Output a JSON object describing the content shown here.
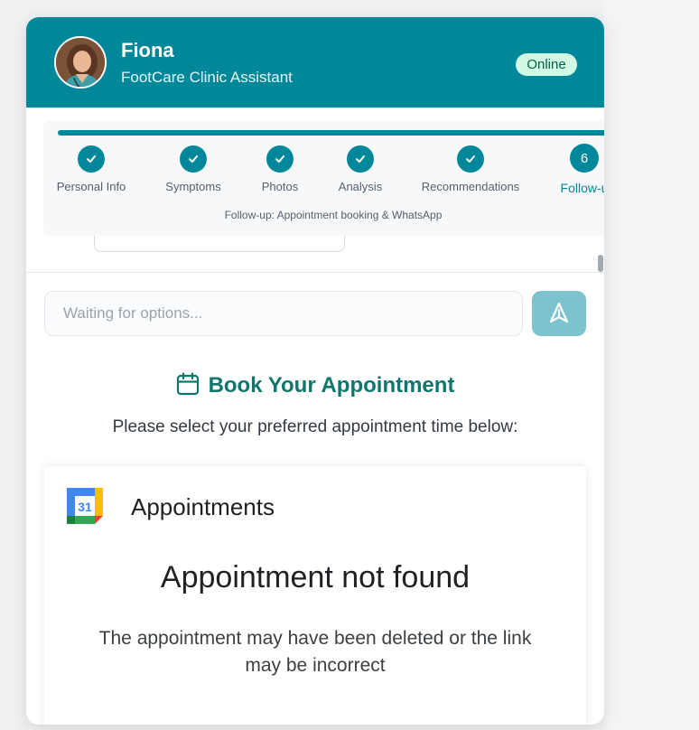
{
  "header": {
    "name": "Fiona",
    "role": "FootCare Clinic Assistant",
    "status": "Online"
  },
  "progress": {
    "steps": [
      {
        "label": "Personal Info",
        "state": "done"
      },
      {
        "label": "Symptoms",
        "state": "done"
      },
      {
        "label": "Photos",
        "state": "done"
      },
      {
        "label": "Analysis",
        "state": "done"
      },
      {
        "label": "Recommendations",
        "state": "done"
      },
      {
        "label": "Follow-u",
        "number": "6",
        "state": "current"
      }
    ],
    "caption": "Follow-up: Appointment booking & WhatsApp"
  },
  "input": {
    "placeholder": "Waiting for options..."
  },
  "booking": {
    "title": "Book Your Appointment",
    "subtitle": "Please select your preferred appointment time below:"
  },
  "embed": {
    "logo_number": "31",
    "app_name": "Appointments",
    "error_title": "Appointment not found",
    "error_text": "The appointment may have been deleted or the link may be incorrect"
  },
  "colors": {
    "header": "#00889a",
    "accent": "#0f766e",
    "status_badge": "#d1fae5",
    "send_button": "#7cc3cd"
  },
  "icons": {
    "send": "send-icon",
    "calendar": "calendar-icon",
    "step_done": "check-icon"
  }
}
